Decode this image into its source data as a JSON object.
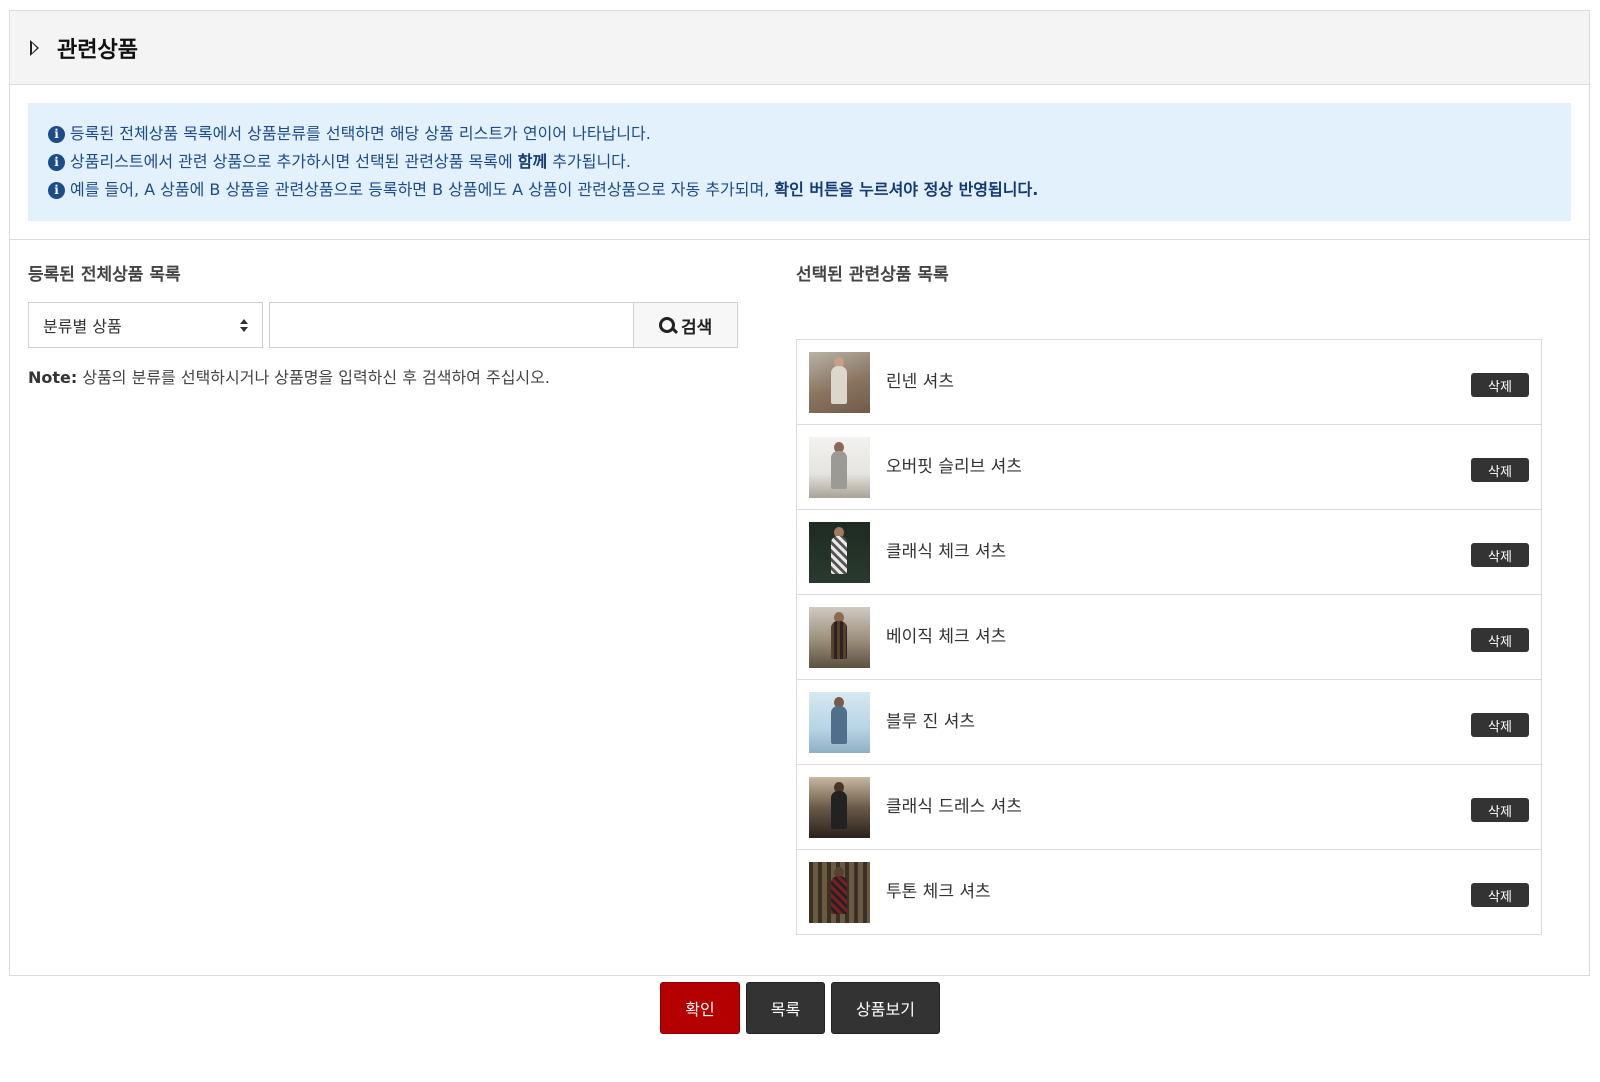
{
  "header": {
    "title": "관련상품"
  },
  "notice": {
    "line1": "등록된 전체상품 목록에서 상품분류를 선택하면 해당 상품 리스트가 연이어 나타납니다.",
    "line2_pre": "상품리스트에서 관련 상품으로 추가하시면 선택된 관련상품 목록에 ",
    "line2_bold": "함께",
    "line2_post": " 추가됩니다.",
    "line3_pre": "예를 들어, A 상품에 B 상품을 관련상품으로 등록하면 B 상품에도 A 상품이 관련상품으로 자동 추가되며, ",
    "line3_bold": "확인 버튼을 누르셔야 정상 반영됩니다."
  },
  "left": {
    "label": "등록된 전체상품 목록",
    "select_value": "분류별 상품",
    "search_value": "",
    "search_button": "검색",
    "note_label": "Note:",
    "note_text": " 상품의 분류를 선택하시거나 상품명을 입력하신 후 검색하여 주십시오."
  },
  "right": {
    "label": "선택된 관련상품 목록",
    "delete_label": "삭제",
    "items": [
      {
        "name": "린넨 셔츠"
      },
      {
        "name": "오버핏 슬리브 셔츠"
      },
      {
        "name": "클래식 체크 셔츠"
      },
      {
        "name": "베이직 체크 셔츠"
      },
      {
        "name": "블루 진 셔츠"
      },
      {
        "name": "클래식 드레스 셔츠"
      },
      {
        "name": "투톤 체크 셔츠"
      }
    ]
  },
  "actions": {
    "confirm": "확인",
    "list": "목록",
    "view": "상품보기"
  }
}
